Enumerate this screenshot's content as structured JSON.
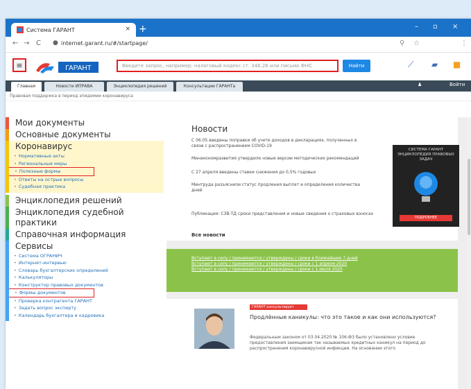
{
  "browser": {
    "tab_title": "Система ГАРАНТ",
    "tab_close": "×",
    "new_tab": "+",
    "win_controls": [
      "–",
      "▫",
      "×"
    ],
    "url": "internet.garant.ru/#/startpage/"
  },
  "header": {
    "search_placeholder": "Введите запрос, например: налоговый кодекс ст. 346.26 или письмо ФНС",
    "search_button": "Найти",
    "logo_text": "ГАРАНТ"
  },
  "doc_tabs": [
    "Главная",
    "Новости ИПРАВА",
    "Энциклопедия решений",
    "Консультации ГАРАНТа"
  ],
  "doc_tabs_right": [
    "Войти"
  ],
  "breadcrumb": "Правовая поддержка в период эпидемии коронавируса",
  "sidebar": {
    "items": [
      {
        "label": "Мои документы",
        "color": "#e8573f",
        "subs": []
      },
      {
        "label": "Основные документы",
        "color": "#f39c12",
        "subs": []
      },
      {
        "label": "Коронавирус",
        "color": "#f1c40f",
        "subs": [
          "Нормативные акты",
          "Региональные меры",
          "Полезные формы",
          "Ответы на острые вопросы",
          "Судебная практика"
        ]
      },
      {
        "label": "Энциклопедия решений",
        "color": "#8bc34a",
        "subs": []
      },
      {
        "label": "Энциклопедия судебной практики",
        "color": "#4caf50",
        "subs": []
      },
      {
        "label": "Справочная информация",
        "color": "#26a69a",
        "subs": []
      },
      {
        "label": "Сервисы",
        "color": "#42a5f5",
        "subs": [
          "Система ОГРАНИЧ",
          "Интернет-интервью",
          "Словарь бухгалтерских определений",
          "Калькуляторы",
          "Конструктор правовых документов",
          "Формы документов",
          "Проверка контрагента ГАРАНТ",
          "Задать вопрос эксперту",
          "Календарь бухгалтера и кадровика"
        ]
      }
    ]
  },
  "news": {
    "title": "Новости",
    "items": [
      "С 06.05 введены поправки об учете доходов в декларациях, полученных в связи с распространением COVID-19",
      "Минэкономразвития утвердило новые версии методических рекомендаций",
      "С 27 апреля введены ставки снижения до 0,5% годовых",
      "Минтруда разъяснили статус продления выплат и определения количества дней",
      "Публикация: СЗВ-ТД сроки представления и новые сведения о страховых взносах"
    ],
    "all_news": "Все новости",
    "promo_top": "СИСТЕМА ГАРАНТ ЭНЦИКЛОПЕДИЯ ПРАВОВЫХ ЗАДАЧ",
    "promo_button": "ПОДРОБНЕЕ"
  },
  "green_banner": {
    "lines": [
      "Вступают в силу / принимаются / утверждены / сроки в ближайшие 7 дней",
      "Вступают в силу / принимаются / утверждены / сроки с 1 апреля 2020",
      "Вступают в силу / принимаются / утверждены / сроки с 1 июля 2020"
    ]
  },
  "article": {
    "tag": "ГАРАНТ консультирует",
    "title": "Продлённые каникулы: что это такое и как они используются?",
    "text": "Федеральным законом от 03.04.2020 № 106-ФЗ было установлено условие предоставления заемщикам так называемых кредитных каникул на период до распространения коронавирусной инфекции. На основании этого"
  },
  "colors": {
    "accent": "#1a73c9",
    "highlight": "#e02020",
    "green": "#8bc34a"
  }
}
